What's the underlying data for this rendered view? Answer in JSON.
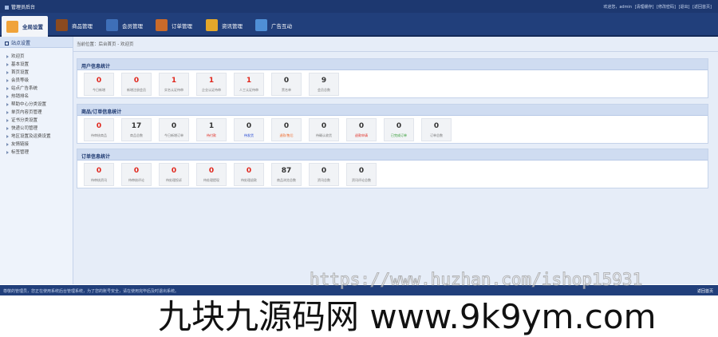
{
  "app": {
    "title": "管理员后台"
  },
  "top_links": [
    "欢迎您，admin",
    "[清理缓存]",
    "[修改密码]",
    "[退出]",
    "[返回首页]"
  ],
  "nav": [
    {
      "label": "全局设置",
      "icon": "gear-icon",
      "color": "#f0a33a",
      "active": true
    },
    {
      "label": "商品管理",
      "icon": "grid-icon",
      "color": "#8b4a1f",
      "active": false
    },
    {
      "label": "会员管理",
      "icon": "user-icon",
      "color": "#3e6fb8",
      "active": false
    },
    {
      "label": "订单管理",
      "icon": "order-icon",
      "color": "#c96a2a",
      "active": false
    },
    {
      "label": "资讯管理",
      "icon": "news-icon",
      "color": "#e4a72a",
      "active": false
    },
    {
      "label": "广告互动",
      "icon": "ad-icon",
      "color": "#4f8fd6",
      "active": false
    }
  ],
  "sidebar": {
    "header": "站点设置",
    "items": [
      "欢迎页",
      "基本设置",
      "首页设置",
      "会员等级",
      "站点广告系统",
      "热销排名",
      "帮助中心分类设置",
      "单页内容页管理",
      "证书分类设置",
      "快递公司管理",
      "地区设置及运费设置",
      "友情链接",
      "标签管理"
    ]
  },
  "breadcrumb": "当前位置：后台首页 - 欢迎页",
  "panels": [
    {
      "title": "用户信息统计",
      "cards": [
        {
          "value": "0",
          "label": "今日新增",
          "color": "#e0261c",
          "label_color": "#777"
        },
        {
          "value": "0",
          "label": "新增注册会员",
          "color": "#e0261c",
          "label_color": "#777"
        },
        {
          "value": "1",
          "label": "实名认证待审",
          "color": "#e0261c",
          "label_color": "#777"
        },
        {
          "value": "1",
          "label": "企业认证待审",
          "color": "#e0261c",
          "label_color": "#777"
        },
        {
          "value": "1",
          "label": "人工认证待审",
          "color": "#e0261c",
          "label_color": "#777"
        },
        {
          "value": "0",
          "label": "黑名单",
          "color": "#333",
          "label_color": "#777"
        },
        {
          "value": "9",
          "label": "会员总数",
          "color": "#333",
          "label_color": "#777"
        }
      ]
    },
    {
      "title": "商品/订单信息统计",
      "cards": [
        {
          "value": "0",
          "label": "待审核商品",
          "color": "#e0261c",
          "label_color": "#777"
        },
        {
          "value": "17",
          "label": "商品总数",
          "color": "#333",
          "label_color": "#777"
        },
        {
          "value": "0",
          "label": "今日新增订单",
          "color": "#333",
          "label_color": "#777"
        },
        {
          "value": "1",
          "label": "待付款",
          "color": "#333",
          "label_color": "#e0261c"
        },
        {
          "value": "0",
          "label": "待发货",
          "color": "#333",
          "label_color": "#1a3fd0"
        },
        {
          "value": "0",
          "label": "退款/售后",
          "color": "#333",
          "label_color": "#f06a2a"
        },
        {
          "value": "0",
          "label": "待确认收货",
          "color": "#333",
          "label_color": "#777"
        },
        {
          "value": "0",
          "label": "退款申请",
          "color": "#333",
          "label_color": "#e0261c"
        },
        {
          "value": "0",
          "label": "已完成订单",
          "color": "#333",
          "label_color": "#2f9a2f"
        },
        {
          "value": "0",
          "label": "订单总数",
          "color": "#333",
          "label_color": "#777"
        }
      ]
    },
    {
      "title": "订单信息统计",
      "cards": [
        {
          "value": "0",
          "label": "待审核资讯",
          "color": "#e0261c",
          "label_color": "#777"
        },
        {
          "value": "0",
          "label": "待审核评论",
          "color": "#e0261c",
          "label_color": "#777"
        },
        {
          "value": "0",
          "label": "待处理投诉",
          "color": "#e0261c",
          "label_color": "#777"
        },
        {
          "value": "0",
          "label": "待处理提现",
          "color": "#e0261c",
          "label_color": "#777"
        },
        {
          "value": "0",
          "label": "待处理退款",
          "color": "#e0261c",
          "label_color": "#777"
        },
        {
          "value": "87",
          "label": "商品浏览总数",
          "color": "#333",
          "label_color": "#777"
        },
        {
          "value": "0",
          "label": "资讯总数",
          "color": "#333",
          "label_color": "#777"
        },
        {
          "value": "0",
          "label": "资讯评论总数",
          "color": "#333",
          "label_color": "#777"
        }
      ]
    }
  ],
  "footer": {
    "message": "尊敬的管理员，您正在使用系统后台管理系统，为了您的账号安全，请在使用完毕后及时退出系统。",
    "home_link": "返回首页"
  },
  "watermarks": {
    "url": "https://www.huzhan.com/ishop15931",
    "site": "九块九源码网 www.9k9ym.com"
  }
}
